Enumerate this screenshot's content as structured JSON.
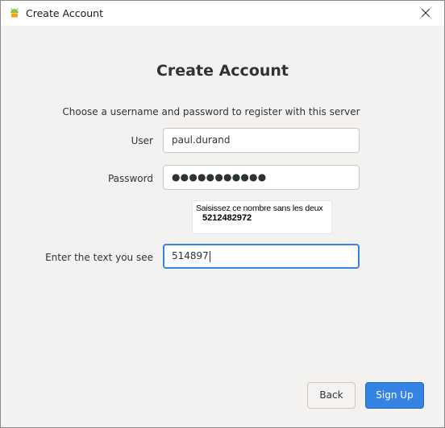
{
  "window": {
    "title": "Create Account"
  },
  "form": {
    "heading": "Create Account",
    "subtitle": "Choose a username and password to register with this server",
    "user_label": "User",
    "user_value": "paul.durand",
    "password_label": "Password",
    "password_value": "●●●●●●●●●●●",
    "captcha_instruction": "Saisissez ce nombre sans les deux",
    "captcha_number": "5212482972",
    "captcha_label": "Enter the text you see",
    "captcha_value": "514897"
  },
  "buttons": {
    "back_label": "Back",
    "signup_label": "Sign Up"
  },
  "colors": {
    "accent": "#3584e4",
    "background": "#f4f2f1"
  },
  "icons": {
    "app": "android-logo-icon",
    "close": "close-icon"
  }
}
